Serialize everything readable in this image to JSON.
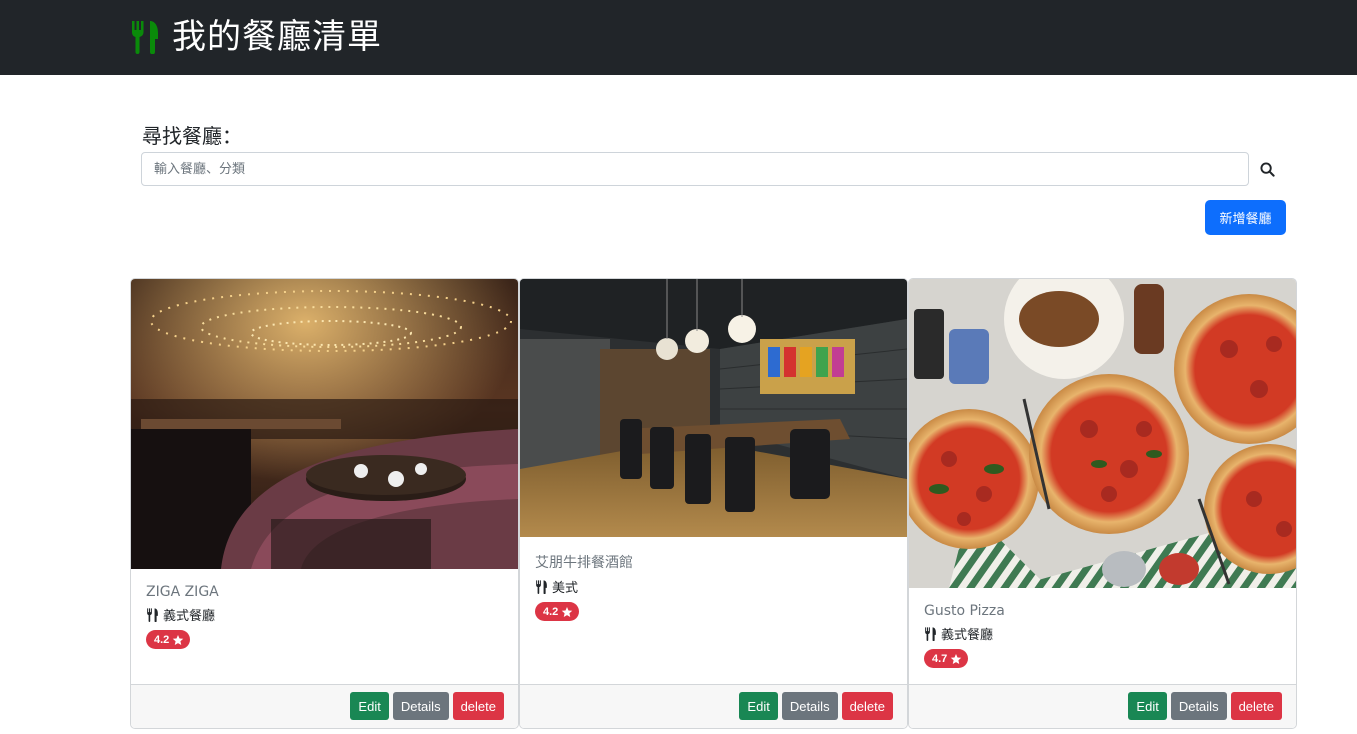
{
  "navbar": {
    "title": "我的餐廳清單",
    "icon": "utensils-icon",
    "icon_color": "#0a8a0a",
    "bg_color": "#212529"
  },
  "search": {
    "label": "尋找餐廳：",
    "placeholder": "輸入餐廳、分類",
    "button_icon": "search-icon"
  },
  "add_button": {
    "label": "新增餐廳",
    "color": "#0d6efd"
  },
  "restaurants": [
    {
      "name": "ZIGA ZIGA",
      "category": "義式餐廳",
      "rating": "4.2",
      "image": "restaurant-interior-photo"
    },
    {
      "name": "艾朋牛排餐酒館",
      "category": "美式",
      "rating": "4.2",
      "image": "dining-room-photo"
    },
    {
      "name": "Gusto Pizza",
      "category": "義式餐廳",
      "rating": "4.7",
      "image": "pizza-photo"
    }
  ],
  "card_buttons": {
    "edit": "Edit",
    "details": "Details",
    "delete": "delete"
  },
  "colors": {
    "edit": "#198754",
    "details": "#6c757d",
    "delete": "#dc3545",
    "badge": "#dc3545"
  }
}
